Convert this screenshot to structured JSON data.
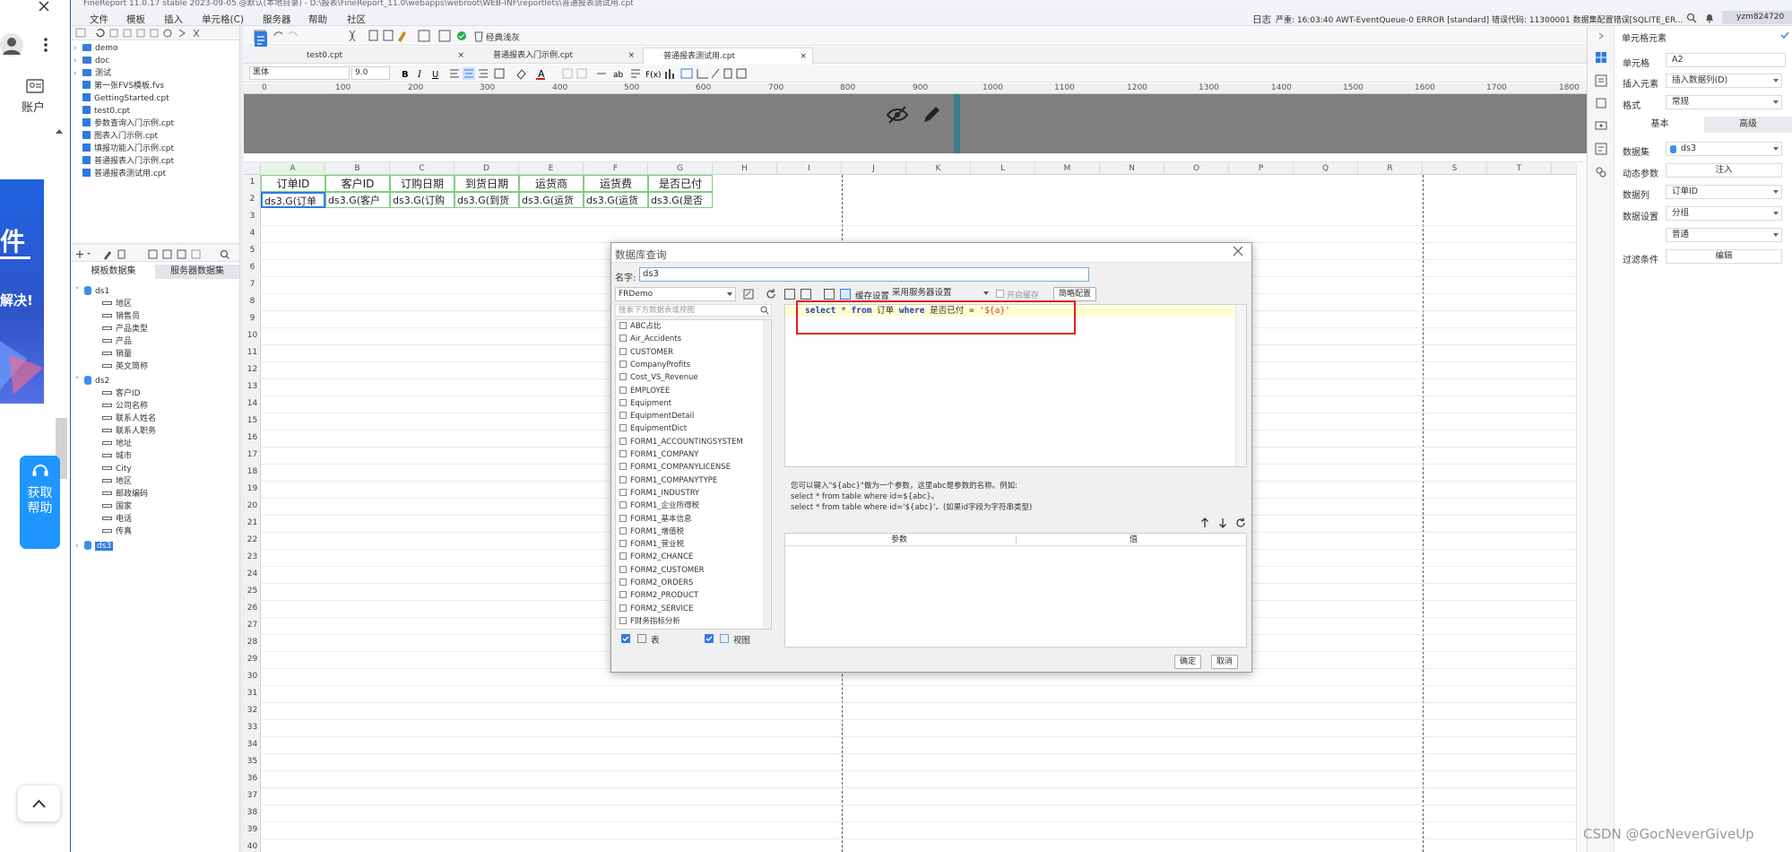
{
  "title_bar": {
    "text": "FineReport 11.0.17 stable 2023-09-05 @默认(本地目录) - D:\\报表\\FineReport_11.0\\webapps\\webroot\\WEB-INF\\reportlets\\普通报表测试用.cpt"
  },
  "menu": {
    "items": [
      "文件",
      "模板",
      "插入",
      "单元格(C)",
      "服务器",
      "帮助",
      "社区"
    ]
  },
  "status": {
    "log_label": "日志",
    "log_text": "严重: 16:03:40 AWT-EventQueue-0 ERROR [standard] 错误代码: 11300001 数据集配置错误[SQLITE_ER...",
    "user": "yzm824720"
  },
  "left_strip": {
    "account_label": "账户",
    "help_label": "获取帮助",
    "banner_texts": [
      "件",
      "解决!"
    ]
  },
  "template_tree": {
    "items": [
      {
        "type": "folder",
        "label": "demo"
      },
      {
        "type": "folder",
        "label": "doc"
      },
      {
        "type": "folder",
        "label": "测试"
      },
      {
        "type": "file",
        "label": "第一张FVS模板.fvs"
      },
      {
        "type": "file",
        "label": "GettingStarted.cpt"
      },
      {
        "type": "file",
        "label": "test0.cpt"
      },
      {
        "type": "file",
        "label": "参数查询入门示例.cpt"
      },
      {
        "type": "file",
        "label": "图表入门示例.cpt"
      },
      {
        "type": "file",
        "label": "填报功能入门示例.cpt"
      },
      {
        "type": "file",
        "label": "普通报表入门示例.cpt"
      },
      {
        "type": "file",
        "label": "普通报表测试用.cpt"
      }
    ]
  },
  "dataset_panel": {
    "tabs": [
      "模板数据集",
      "服务器数据集"
    ],
    "datasets": [
      {
        "name": "ds1",
        "fields": [
          "地区",
          "销售员",
          "产品类型",
          "产品",
          "销量",
          "英文简称"
        ]
      },
      {
        "name": "ds2",
        "fields": [
          "客户ID",
          "公司名称",
          "联系人姓名",
          "联系人职务",
          "地址",
          "城市",
          "City",
          "地区",
          "邮政编码",
          "国家",
          "电话",
          "传真"
        ]
      },
      {
        "name": "ds3",
        "fields": []
      }
    ]
  },
  "file_tabs": [
    "test0.cpt",
    "普通报表入门示例.cpt",
    "普通报表测试用.cpt"
  ],
  "format_bar": {
    "font": "黑体",
    "size": "9.0"
  },
  "ruler": {
    "labels": [
      "0",
      "100",
      "200",
      "300",
      "400",
      "500",
      "600",
      "700",
      "800",
      "900",
      "1000",
      "1100",
      "1200",
      "1300",
      "1400",
      "1500",
      "1600",
      "1700",
      "1800"
    ]
  },
  "sheet": {
    "columns": [
      "A",
      "B",
      "C",
      "D",
      "E",
      "F",
      "G",
      "H",
      "I",
      "J",
      "K",
      "L",
      "M",
      "N",
      "O",
      "P",
      "Q",
      "R",
      "S",
      "T"
    ],
    "rows": [
      "1",
      "2",
      "3",
      "4",
      "5",
      "6",
      "7",
      "8",
      "9",
      "10",
      "11",
      "12",
      "13",
      "14",
      "15",
      "16",
      "17",
      "18",
      "19",
      "20",
      "21",
      "22",
      "23",
      "24",
      "25",
      "26",
      "27",
      "28",
      "29",
      "30",
      "31",
      "32",
      "33",
      "34",
      "35",
      "36",
      "37",
      "38",
      "39",
      "40"
    ],
    "header_row": [
      "订单ID",
      "客户ID",
      "订购日期",
      "到货日期",
      "运货商",
      "运货费",
      "是否已付"
    ],
    "data_row": [
      "ds3.G(订单",
      "ds3.G(客户",
      "ds3.G(订购",
      "ds3.G(到货",
      "ds3.G(运货",
      "ds3.G(运货",
      "ds3.G(是否"
    ]
  },
  "dialog": {
    "title": "数据库查询",
    "name_label": "名字:",
    "name_value": "ds3",
    "connection": "FRDemo",
    "search_placeholder": "搜索下方数据表或视图",
    "tables": [
      "ABC占比",
      "Air_Accidents",
      "CUSTOMER",
      "CompanyProfits",
      "Cost_VS_Revenue",
      "EMPLOYEE",
      "Equipment",
      "EquipmentDetail",
      "EquipmentDict",
      "FORM1_ACCOUNTINGSYSTEM",
      "FORM1_COMPANY",
      "FORM1_COMPANYLICENSE",
      "FORM1_COMPANYTYPE",
      "FORM1_INDUSTRY",
      "FORM1_企业所得税",
      "FORM1_基本信息",
      "FORM1_增值税",
      "FORM1_营业税",
      "FORM2_CHANCE",
      "FORM2_CUSTOMER",
      "FORM2_ORDERS",
      "FORM2_PRODUCT",
      "FORM2_SERVICE",
      "F财务指标分析"
    ],
    "show_table_label": "表",
    "show_view_label": "视图",
    "toolbar": {
      "cache": "缓存设置",
      "server_setting": "采用服务器设置",
      "enable_cache": "开启缓存",
      "pagination": "简略配置"
    },
    "sql": {
      "select": "select",
      "star": "*",
      "from": "from",
      "table": "订单",
      "where": "where",
      "column": "是否已付",
      "eq": "=",
      "param": "'${a}'"
    },
    "hint_lines": [
      "您可以键入\"${abc}\"做为一个参数，这里abc是参数的名称。例如:",
      "select * from table where id=${abc}。",
      "select * from table where id='${abc}'。(如果id字段为字符串类型)"
    ],
    "param_headers": [
      "参数",
      "值"
    ],
    "ok": "确定",
    "cancel": "取消"
  },
  "right_panel": {
    "title": "单元格元素",
    "cell_label": "单元格",
    "cell_value": "A2",
    "insert_label": "插入元素",
    "insert_value": "插入数据列(D)",
    "format_label": "格式",
    "format_value": "常规",
    "tabs": [
      "基本",
      "高级"
    ],
    "dataset_label": "数据集",
    "dataset_value": "ds3",
    "dynamic_label": "动态参数",
    "inject": "注入",
    "column_label": "数据列",
    "column_value": "订单ID",
    "setting_label": "数据设置",
    "setting_value": "分组",
    "setting_sub": "普通",
    "filter_label": "过滤条件",
    "edit": "编辑"
  },
  "watermark": "CSDN @GocNeverGiveUp",
  "colors": {
    "accent": "#1e95ff",
    "highlight_box": "#e02020",
    "cell_border": "#7cd07c",
    "selection": "#2f7be3",
    "sql_line": "#fffcd0"
  }
}
